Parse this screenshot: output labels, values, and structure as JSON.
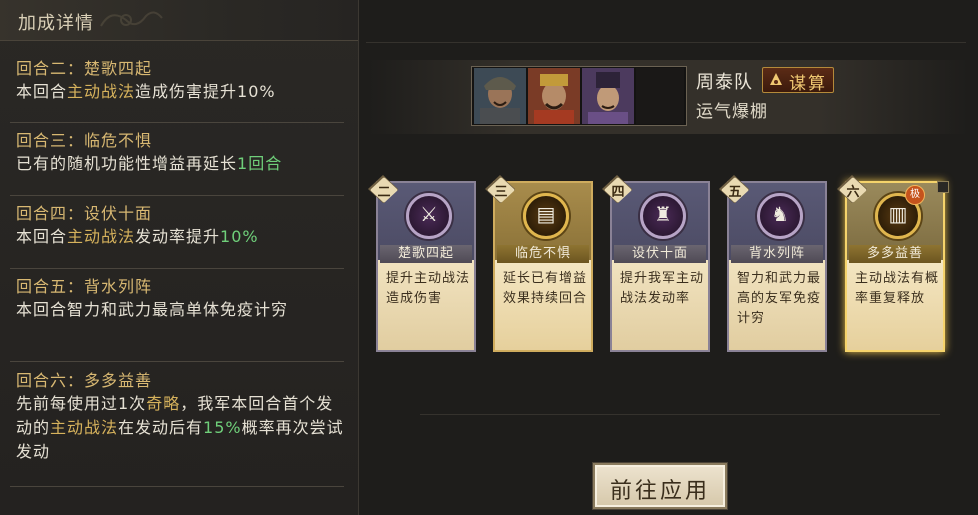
{
  "panel_title": "加成详情",
  "bonuses": [
    {
      "head": "回合二：楚歌四起",
      "desc": [
        {
          "t": "本回合",
          "c": "w"
        },
        {
          "t": "主动战法",
          "c": "hl"
        },
        {
          "t": "造成伤害提升10%",
          "c": "w"
        }
      ]
    },
    {
      "head": "回合三：临危不惧",
      "desc": [
        {
          "t": "已有的随机功能性增益再延长",
          "c": "w"
        },
        {
          "t": "1回合",
          "c": "gn"
        }
      ]
    },
    {
      "head": "回合四：设伏十面",
      "desc": [
        {
          "t": "本回合",
          "c": "w"
        },
        {
          "t": "主动战法",
          "c": "hl"
        },
        {
          "t": "发动率提升",
          "c": "w"
        },
        {
          "t": "10%",
          "c": "gn"
        }
      ]
    },
    {
      "head": "回合五：背水列阵",
      "desc": [
        {
          "t": "本回合智力和武力最高单体免疫计穷",
          "c": "w"
        }
      ]
    },
    {
      "head": "回合六：多多益善",
      "desc": [
        {
          "t": "先前每使用过1次",
          "c": "w"
        },
        {
          "t": "奇略",
          "c": "hl"
        },
        {
          "t": "，我军本回合首个发动的",
          "c": "w"
        },
        {
          "t": "主动战法",
          "c": "hl"
        },
        {
          "t": "在发动后有",
          "c": "w"
        },
        {
          "t": "15%",
          "c": "gn"
        },
        {
          "t": "概率再次尝试发动",
          "c": "w"
        }
      ]
    }
  ],
  "team": {
    "name": "周泰队",
    "strategy_tag": "谋算",
    "subtitle": "运气爆棚"
  },
  "cards": [
    {
      "num": "二",
      "name": "楚歌四起",
      "desc": "提升主动战法造成伤害",
      "style": "purple",
      "icon": "dancer-icon",
      "glyph": "⚔"
    },
    {
      "num": "三",
      "name": "临危不惧",
      "desc": "延长已有增益效果持续回合",
      "style": "gold",
      "icon": "scroll-icon",
      "glyph": "▤"
    },
    {
      "num": "四",
      "name": "设伏十面",
      "desc": "提升我军主动战法发动率",
      "style": "purple",
      "icon": "army-icon",
      "glyph": "♜"
    },
    {
      "num": "五",
      "name": "背水列阵",
      "desc": "智力和武力最高的友军免疫计穷",
      "style": "purple",
      "icon": "warrior-icon",
      "glyph": "♞"
    },
    {
      "num": "六",
      "name": "多多益善",
      "desc": "主动战法有概率重复释放",
      "style": "special",
      "icon": "bamboo-scroll-icon",
      "glyph": "▥",
      "rank": "极"
    }
  ],
  "go_button": "前往应用"
}
